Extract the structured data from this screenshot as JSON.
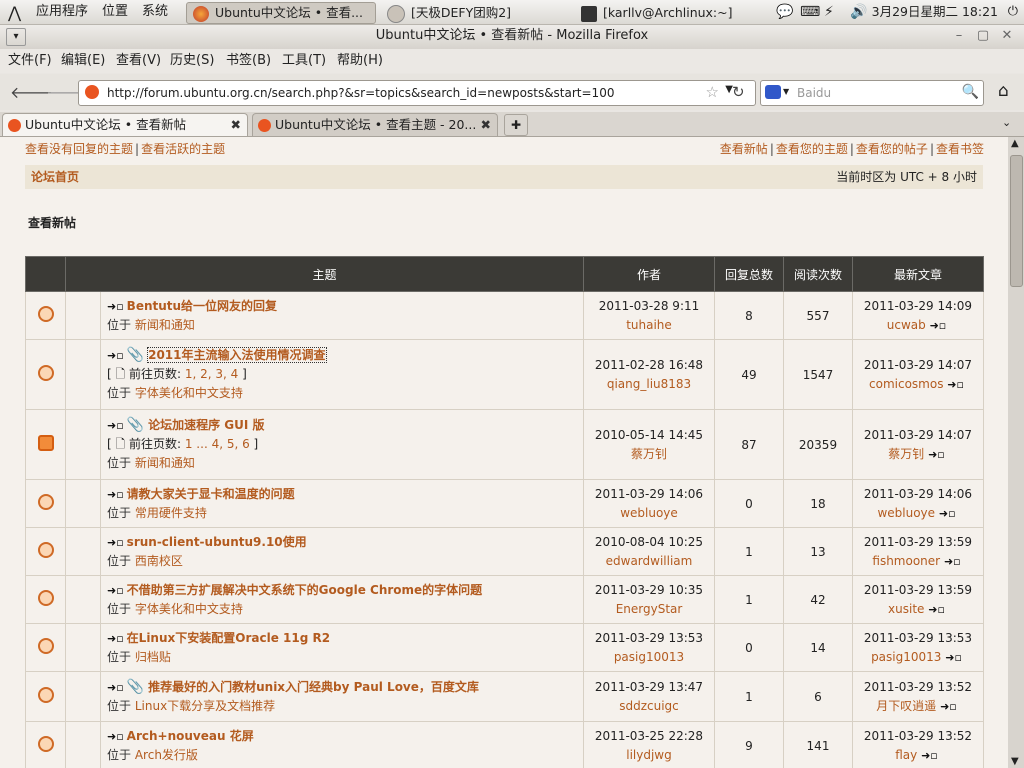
{
  "panel": {
    "apps": "应用程序",
    "places": "位置",
    "system": "系统",
    "tasks": [
      {
        "label": "Ubuntu中文论坛 • 查看..."
      },
      {
        "label": "[天极DEFY团购2]"
      },
      {
        "label": "[karllv@Archlinux:~]"
      }
    ],
    "clock": "3月29日星期二 18:21"
  },
  "window": {
    "title": "Ubuntu中文论坛 • 查看新帖 - Mozilla Firefox"
  },
  "menu": [
    "文件(F)",
    "编辑(E)",
    "查看(V)",
    "历史(S)",
    "书签(B)",
    "工具(T)",
    "帮助(H)"
  ],
  "nav": {
    "url": "http://forum.ubuntu.org.cn/search.php?&sr=topics&search_id=newposts&start=100",
    "search_placeholder": "Baidu"
  },
  "tabs": [
    {
      "label": "Ubuntu中文论坛 • 查看新帖"
    },
    {
      "label": "Ubuntu中文论坛 • 查看主题 - 20..."
    }
  ],
  "page": {
    "left_links": [
      "查看没有回复的主题",
      "查看活跃的主题"
    ],
    "right_links": [
      "查看新帖",
      "查看您的主题",
      "查看您的帖子",
      "查看书签"
    ],
    "crumb": "论坛首页",
    "timezone": "当前时区为 UTC + 8 小时",
    "heading": "查看新帖",
    "cols": {
      "topic": "主题",
      "author": "作者",
      "replies": "回复总数",
      "views": "阅读次数",
      "last": "最新文章"
    },
    "loc_prefix": "位于",
    "goto_prefix": "前往页数:",
    "topics": [
      {
        "title": "Bentutu给一位网友的回复",
        "forum": "新闻和通知",
        "date": "2011-03-28 9:11",
        "author": "tuhaihe",
        "replies": "8",
        "views": "557",
        "last_date": "2011-03-29 14:09",
        "last_author": "ucwab",
        "clip": false,
        "pages": null,
        "hot": false
      },
      {
        "title": "2011年主流输入法使用情况调查",
        "forum": "字体美化和中文支持",
        "date": "2011-02-28 16:48",
        "author": "qiang_liu8183",
        "replies": "49",
        "views": "1547",
        "last_date": "2011-03-29 14:07",
        "last_author": "comicosmos",
        "clip": true,
        "pages": "1, 2, 3, 4",
        "hot": false,
        "focused": true
      },
      {
        "title": "论坛加速程序 GUI 版",
        "forum": "新闻和通知",
        "date": "2010-05-14 14:45",
        "author": "蔡万钊",
        "replies": "87",
        "views": "20359",
        "last_date": "2011-03-29 14:07",
        "last_author": "蔡万钊",
        "clip": true,
        "pages": "1 ... 4, 5, 6",
        "hot": true
      },
      {
        "title": "请教大家关于显卡和温度的问题",
        "forum": "常用硬件支持",
        "date": "2011-03-29 14:06",
        "author": "webluoye",
        "replies": "0",
        "views": "18",
        "last_date": "2011-03-29 14:06",
        "last_author": "webluoye",
        "clip": false,
        "pages": null,
        "hot": false
      },
      {
        "title": "srun-client-ubuntu9.10使用",
        "forum": "西南校区",
        "date": "2010-08-04 10:25",
        "author": "edwardwilliam",
        "replies": "1",
        "views": "13",
        "last_date": "2011-03-29 13:59",
        "last_author": "fishmooner",
        "clip": false,
        "pages": null,
        "hot": false
      },
      {
        "title": "不借助第三方扩展解决中文系统下的Google Chrome的字体问题",
        "forum": "字体美化和中文支持",
        "date": "2011-03-29 10:35",
        "author": "EnergyStar",
        "replies": "1",
        "views": "42",
        "last_date": "2011-03-29 13:59",
        "last_author": "xusite",
        "clip": false,
        "pages": null,
        "hot": false
      },
      {
        "title": "在Linux下安装配置Oracle 11g R2",
        "forum": "归档贴",
        "date": "2011-03-29 13:53",
        "author": "pasig10013",
        "replies": "0",
        "views": "14",
        "last_date": "2011-03-29 13:53",
        "last_author": "pasig10013",
        "clip": false,
        "pages": null,
        "hot": false
      },
      {
        "title": "推荐最好的入门教材unix入门经典by Paul Love，百度文库",
        "forum": "Linux下载分享及文档推荐",
        "date": "2011-03-29 13:47",
        "author": "sddzcuigc",
        "replies": "1",
        "views": "6",
        "last_date": "2011-03-29 13:52",
        "last_author": "月下叹逍遥",
        "clip": true,
        "pages": null,
        "hot": false
      },
      {
        "title": "Arch+nouveau 花屏",
        "forum": "Arch发行版",
        "date": "2011-03-25 22:28",
        "author": "lilydjwg",
        "replies": "9",
        "views": "141",
        "last_date": "2011-03-29 13:52",
        "last_author": "flay",
        "clip": false,
        "pages": null,
        "hot": false
      }
    ]
  }
}
